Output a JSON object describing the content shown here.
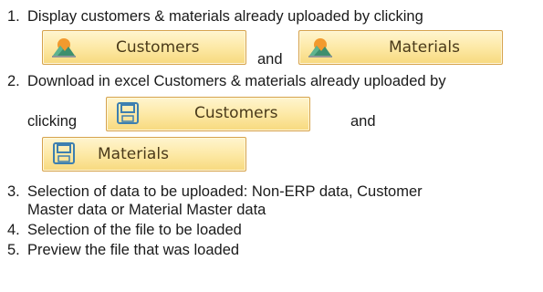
{
  "items": [
    {
      "num": "1.",
      "text": "Display customers & materials already uploaded by clicking"
    },
    {
      "num": "2.",
      "text_line1": "Download in excel Customers & materials already uploaded by",
      "text_line2": "clicking"
    },
    {
      "num": "3.",
      "text_line1": "Selection of data to be uploaded: Non-ERP data, Customer",
      "text_line2": "Master data or Material Master data"
    },
    {
      "num": "4.",
      "text": "Selection of the file to be loaded"
    },
    {
      "num": "5.",
      "text": "Preview the file that was loaded"
    }
  ],
  "connector": "and",
  "buttons": {
    "display_customers": {
      "label": "Customers",
      "icon": "landscape-image-icon"
    },
    "display_materials": {
      "label": "Materials",
      "icon": "landscape-image-icon"
    },
    "download_customers": {
      "label": "Customers",
      "icon": "floppy-disk-icon"
    },
    "download_materials": {
      "label": "Materials",
      "icon": "floppy-disk-icon"
    }
  }
}
